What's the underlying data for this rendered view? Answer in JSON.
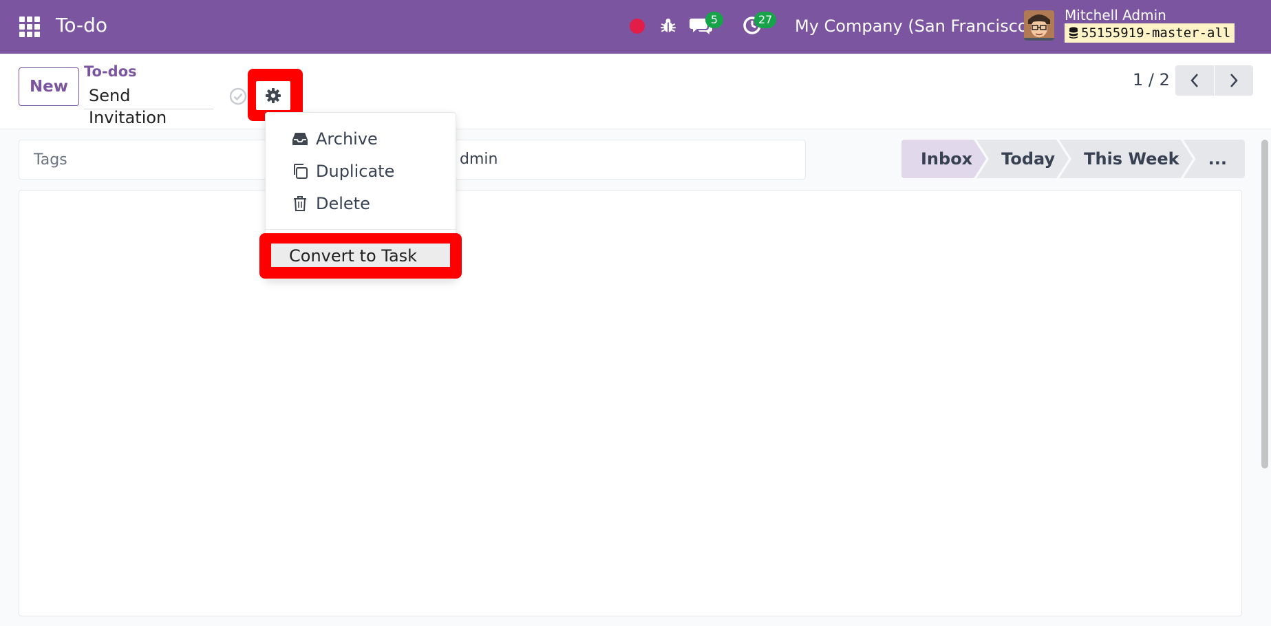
{
  "navbar": {
    "app_title": "To-do",
    "chat_count": "5",
    "activity_count": "27",
    "company": "My Company (San Francisco)",
    "user_name": "Mitchell Admin",
    "db_name": "55155919-master-all"
  },
  "control": {
    "new_label": "New",
    "breadcrumb": "To-dos",
    "record_name": "Send Invitation",
    "pager": "1 / 2"
  },
  "form": {
    "tags_placeholder": "Tags",
    "assignee_partial": "dmin",
    "stages": [
      "Inbox",
      "Today",
      "This Week",
      "..."
    ]
  },
  "dropdown": {
    "archive": "Archive",
    "duplicate": "Duplicate",
    "delete": "Delete",
    "convert": "Convert to Task"
  },
  "colors": {
    "brand": "#7c55a0",
    "badge": "#16a34a",
    "highlight": "#ff0000"
  }
}
